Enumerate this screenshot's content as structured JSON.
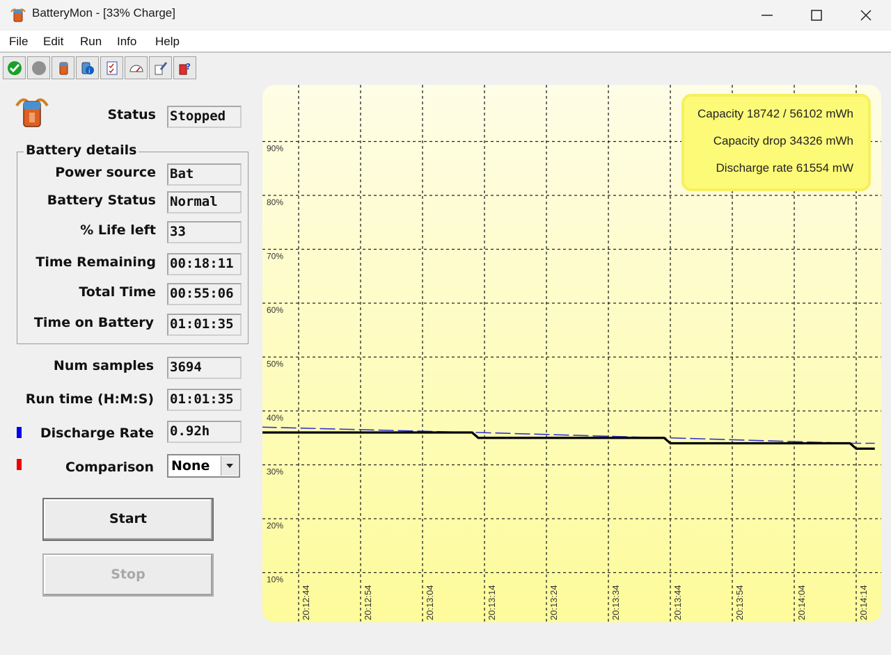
{
  "window": {
    "title": "BatteryMon - [33% Charge]",
    "app_icon": "battery-app-icon",
    "controls": [
      "minimize-icon",
      "maximize-icon",
      "close-icon"
    ]
  },
  "menu": [
    "File",
    "Edit",
    "Run",
    "Info",
    "Help"
  ],
  "toolbar": [
    "start-green-check-icon",
    "stop-grey-circle-icon",
    "battery-icon",
    "battery-info-icon",
    "checklist-icon",
    "gauge-icon",
    "settings-wrench-icon",
    "help-icon"
  ],
  "status": {
    "label": "Status",
    "value": "Stopped"
  },
  "battery_details": {
    "title": "Battery details",
    "fields": [
      {
        "label": "Power source",
        "value": "Bat"
      },
      {
        "label": "Battery Status",
        "value": "Normal"
      },
      {
        "label": "% Life left",
        "value": "33"
      },
      {
        "label": "Time Remaining",
        "value": "00:18:11"
      },
      {
        "label": "Total Time",
        "value": "00:55:06"
      },
      {
        "label": "Time on Battery",
        "value": "01:01:35"
      }
    ]
  },
  "stats": [
    {
      "label": "Num samples",
      "value": "3694"
    },
    {
      "label": "Run time (H:M:S)",
      "value": "01:01:35"
    },
    {
      "label": "Discharge Rate",
      "value": "0.92h",
      "marker_color": "#0000ee"
    }
  ],
  "comparison": {
    "label": "Comparison",
    "selected": "None",
    "marker_color": "#ee0000"
  },
  "buttons": {
    "start": "Start",
    "stop": "Stop"
  },
  "chart_data": {
    "type": "line",
    "y_ticks": [
      "90%",
      "80%",
      "70%",
      "60%",
      "50%",
      "40%",
      "30%",
      "20%",
      "10%"
    ],
    "x_ticks": [
      "20:12:44",
      "20:12:54",
      "20:13:04",
      "20:13:14",
      "20:13:24",
      "20:13:34",
      "20:13:44",
      "20:13:54",
      "20:14:04",
      "20:14:14"
    ],
    "ylim": [
      0,
      100
    ],
    "grid": true,
    "legend": {
      "placement": "top-right",
      "lines": [
        "Capacity 18742 / 56102 mWh",
        "Capacity drop 34326 mWh",
        "Discharge rate 61554 mW"
      ]
    },
    "series": [
      {
        "color": "#000000",
        "style": "solid",
        "points": [
          [
            "20:12:38",
            36
          ],
          [
            "20:13:12",
            36
          ],
          [
            "20:13:13",
            35
          ],
          [
            "20:13:43",
            35
          ],
          [
            "20:13:44",
            34
          ],
          [
            "20:14:13",
            34
          ],
          [
            "20:14:14",
            33
          ],
          [
            "20:14:17",
            33
          ]
        ]
      },
      {
        "color": "#3333cc",
        "style": "dashed",
        "points": [
          [
            "20:12:38",
            37
          ],
          [
            "20:13:12",
            36
          ],
          [
            "20:13:13",
            36
          ],
          [
            "20:13:43",
            35
          ],
          [
            "20:13:44",
            35
          ],
          [
            "20:14:13",
            34
          ],
          [
            "20:14:14",
            34
          ],
          [
            "20:14:17",
            34
          ]
        ]
      }
    ]
  }
}
